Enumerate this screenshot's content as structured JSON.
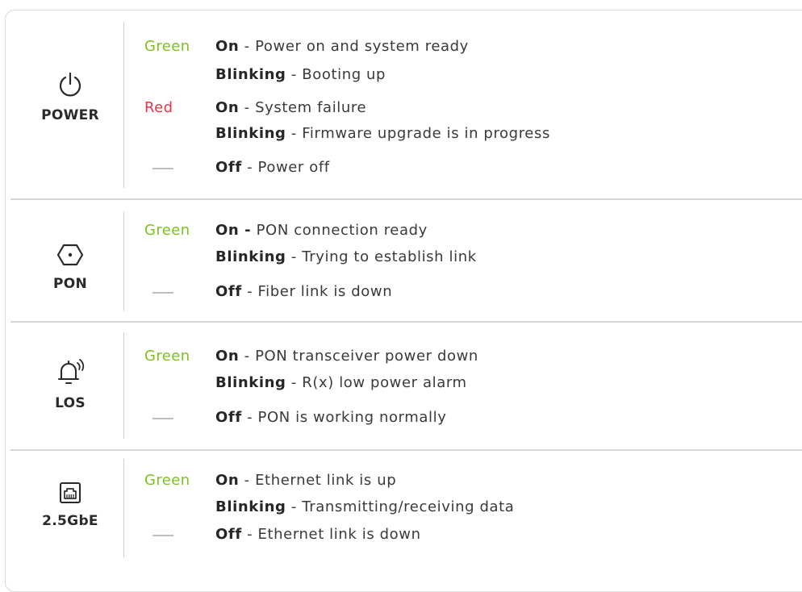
{
  "sections": [
    {
      "led": "POWER",
      "icon": "power-icon",
      "rows": [
        {
          "color": "Green",
          "color_class": "green",
          "state": "On",
          "sep": " - ",
          "text": "Power on and system ready"
        },
        {
          "color": "",
          "color_class": "",
          "state": "Blinking",
          "sep": " - ",
          "text": "Booting up"
        },
        {
          "color": "Red",
          "color_class": "red",
          "state": "On",
          "sep": " - ",
          "text": "System failure"
        },
        {
          "color": "",
          "color_class": "",
          "state": "Blinking",
          "sep": " - ",
          "text": "Firmware upgrade is in progress"
        },
        {
          "color": "—",
          "color_class": "dash",
          "state": "Off",
          "sep": " - ",
          "text": "Power off"
        }
      ]
    },
    {
      "led": "PON",
      "icon": "pon-hexagon-icon",
      "rows": [
        {
          "color": "Green",
          "color_class": "green",
          "state": "On -",
          "sep": " ",
          "text": "PON connection ready"
        },
        {
          "color": "",
          "color_class": "",
          "state": "Blinking",
          "sep": " - ",
          "text": "Trying to establish link"
        },
        {
          "color": "—",
          "color_class": "dash",
          "state": "Off",
          "sep": " - ",
          "text": "Fiber link is down"
        }
      ]
    },
    {
      "led": "LOS",
      "icon": "bell-alarm-icon",
      "rows": [
        {
          "color": "Green",
          "color_class": "green",
          "state": "On",
          "sep": " - ",
          "text": "PON transceiver power down"
        },
        {
          "color": "",
          "color_class": "",
          "state": "Blinking",
          "sep": " - ",
          "text": "R(x) low power alarm"
        },
        {
          "color": "—",
          "color_class": "dash",
          "state": "Off",
          "sep": " - ",
          "text": "PON is working normally"
        }
      ]
    },
    {
      "led": "2.5GbE",
      "icon": "ethernet-port-icon",
      "rows": [
        {
          "color": "Green",
          "color_class": "green",
          "state": "On",
          "sep": " - ",
          "text": "Ethernet link is up"
        },
        {
          "color": "",
          "color_class": "",
          "state": "Blinking",
          "sep": " - ",
          "text": "Transmitting/receiving data"
        },
        {
          "color": "—",
          "color_class": "dash",
          "state": "Off",
          "sep": " - ",
          "text": "Ethernet link is down"
        }
      ]
    }
  ],
  "colors": {
    "green": "#7cc21f",
    "red": "#e8334a",
    "text": "#3a3a3a",
    "divider": "#d6d6d6"
  }
}
